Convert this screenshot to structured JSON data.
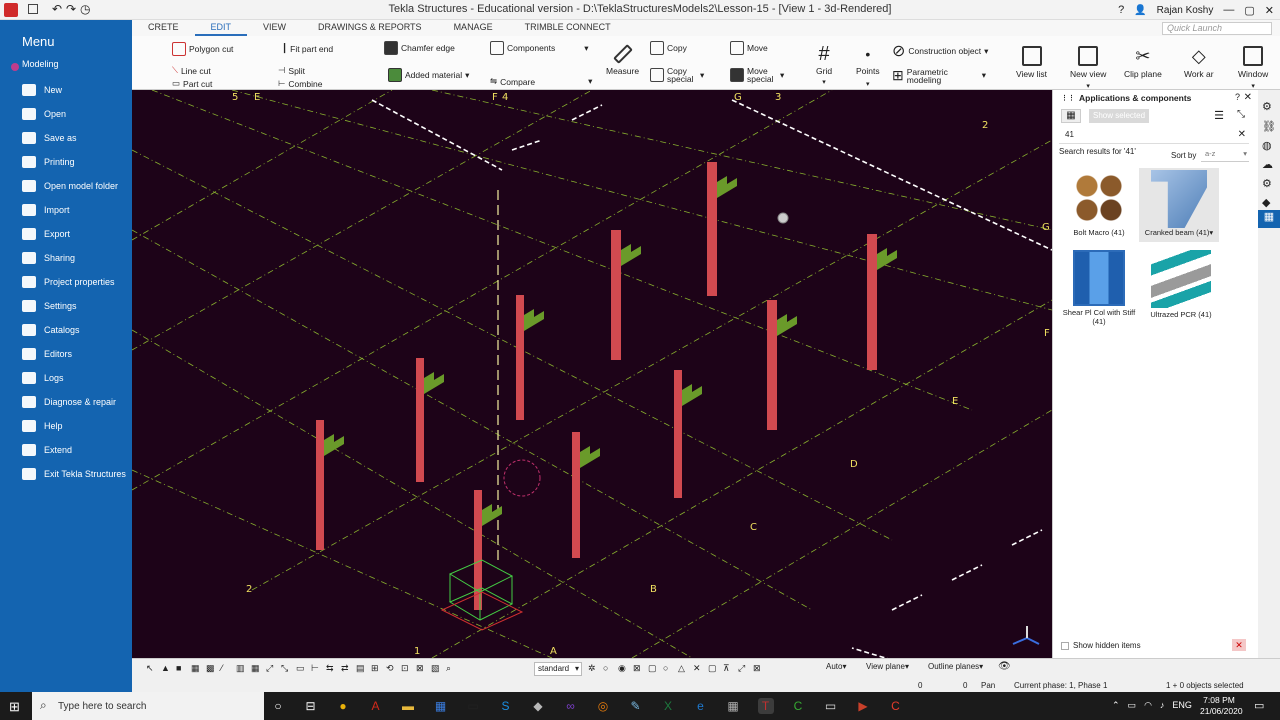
{
  "window": {
    "title": "Tekla Structures - Educational version - D:\\TeklaStructuresModels2\\Lesson-15 - [View 1 - 3d-Rendered]",
    "user": "Rajan Koshy",
    "quick_launch": "Quick Launch"
  },
  "tabs": [
    "CRETE",
    "EDIT",
    "VIEW",
    "DRAWINGS & REPORTS",
    "MANAGE",
    "TRIMBLE CONNECT"
  ],
  "ribbon": {
    "polygon_cut": "Polygon cut",
    "line_cut": "Line cut",
    "part_cut": "Part cut",
    "fit_part_end": "Fit part end",
    "split": "Split",
    "combine": "Combine",
    "chamfer_edge": "Chamfer edge",
    "added_material": "Added material",
    "components": "Components",
    "compare": "Compare",
    "measure": "Measure",
    "copy": "Copy",
    "copy_special": "Copy special",
    "move": "Move",
    "move_special": "Move special",
    "grid": "Grid",
    "points": "Points",
    "construction_object": "Construction object",
    "parametric_modeling": "Parametric modeling",
    "view_list": "View list",
    "new_view": "New view",
    "clip_plane": "Clip plane",
    "work_area": "Work ar",
    "window": "Window"
  },
  "menu": {
    "title": "Menu",
    "mode": "Modeling",
    "items": [
      "New",
      "Open",
      "Save as",
      "Printing",
      "Open model folder",
      "Import",
      "Export",
      "Sharing",
      "Project properties",
      "Settings",
      "Catalogs",
      "Editors",
      "Logs",
      "Diagnose & repair",
      "Help",
      "Extend",
      "Exit Tekla Structures"
    ]
  },
  "viewport": {
    "grid_labels": [
      "5",
      "E",
      "F",
      "4",
      "G",
      "3",
      "2",
      "G",
      "F",
      "E",
      "D",
      "C",
      "B",
      "A",
      "1",
      "2"
    ]
  },
  "panel": {
    "title": "Applications & components",
    "show_selected": "Show selected",
    "search_value": "41",
    "results_label": "Search results for '41'",
    "sort_label": "Sort by",
    "sort_value": "a-z",
    "results": [
      {
        "name": "Bolt Macro (41)",
        "color": "#8b5a2b"
      },
      {
        "name": "Cranked beam (41)",
        "color": "#6a9fd8"
      },
      {
        "name": "Shear Pl Col with Stiff (41)",
        "color": "#2e7dd1"
      },
      {
        "name": "Ultrazed PCR (41)",
        "color": "#1aa3a8"
      }
    ],
    "show_hidden": "Show hidden items"
  },
  "bottom_toolbar": {
    "standard": "standard",
    "auto": "Auto",
    "view_plane": "View plane",
    "outline_planes": "Outline planes"
  },
  "status": {
    "x": "0",
    "y": "0",
    "mode": "Pan",
    "phase": "Current phase: 1, Phase 1",
    "selected": "1 + 0 objects selected"
  },
  "taskbar": {
    "search": "Type here to search",
    "lang": "ENG",
    "time": "7:08 PM",
    "date": "21/06/2020"
  }
}
